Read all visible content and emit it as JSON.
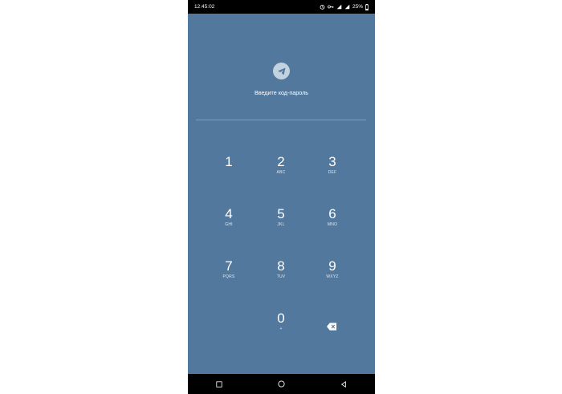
{
  "status_bar": {
    "time": "12:45:02",
    "battery_text": "25%",
    "icons": [
      "alarm-icon",
      "key-icon",
      "signal-icon",
      "signal-icon",
      "battery-icon"
    ]
  },
  "header": {
    "logo_icon": "telegram-logo-icon",
    "prompt": "Введите код-пароль"
  },
  "keypad": {
    "keys": [
      {
        "digit": "1",
        "letters": ""
      },
      {
        "digit": "2",
        "letters": "ABC"
      },
      {
        "digit": "3",
        "letters": "DEF"
      },
      {
        "digit": "4",
        "letters": "GHI"
      },
      {
        "digit": "5",
        "letters": "JKL"
      },
      {
        "digit": "6",
        "letters": "MNO"
      },
      {
        "digit": "7",
        "letters": "PQRS"
      },
      {
        "digit": "8",
        "letters": "TUV"
      },
      {
        "digit": "9",
        "letters": "WXYZ"
      },
      {
        "digit": "0",
        "letters": "+"
      }
    ],
    "backspace_icon": "backspace-icon"
  },
  "nav_bar": {
    "icons": [
      "recents-square-icon",
      "home-circle-icon",
      "back-triangle-icon"
    ]
  },
  "colors": {
    "background": "#52799d",
    "accent_line": "#79a0c5",
    "bars": "#000000"
  }
}
